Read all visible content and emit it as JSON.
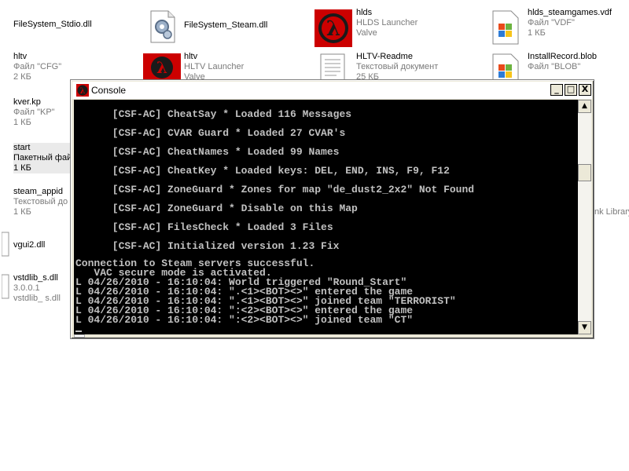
{
  "desktop": {
    "left_files": [
      {
        "name": "FileSystem_Stdio.dll",
        "sub1": "",
        "sub2": ""
      },
      {
        "name": "hltv",
        "sub1": "Файл \"CFG\"",
        "sub2": "2 КБ"
      },
      {
        "name": "kver.kp",
        "sub1": "Файл \"KP\"",
        "sub2": "1 КБ"
      },
      {
        "name": "start",
        "sub1": "Пакетный файл",
        "sub2": "1 КБ"
      },
      {
        "name": "steam_appid",
        "sub1": "Текстовый до",
        "sub2": "1 КБ"
      },
      {
        "name": "vgui2.dll",
        "sub1": "",
        "sub2": ""
      },
      {
        "name": "vstdlib_s.dll",
        "sub1": "3.0.0.1",
        "sub2": "vstdlib_ s.dll"
      }
    ],
    "mid_files": [
      {
        "name": "FileSystem_Steam.dll",
        "sub1": "",
        "sub2": ""
      },
      {
        "name": "hltv",
        "sub1": "HLTV Launcher",
        "sub2": "Valve"
      }
    ],
    "right_files": [
      {
        "name": "hlds",
        "sub1": "HLDS Launcher",
        "sub2": "Valve"
      },
      {
        "name": "HLTV-Readme",
        "sub1": "Текстовый документ",
        "sub2": "25 КБ"
      }
    ],
    "far_files": [
      {
        "name": "hlds_steamgames.vdf",
        "sub1": "Файл \"VDF\"",
        "sub2": "1 КБ"
      },
      {
        "name": "InstallRecord.blob",
        "sub1": "Файл \"BLOB\"",
        "sub2": "1 КБ"
      }
    ],
    "partial_text": "nk Library"
  },
  "console": {
    "title": "Console",
    "minimize_glyph": "_",
    "maximize_glyph": "□",
    "close_glyph": "X",
    "scroll_up_glyph": "▲",
    "scroll_down_glyph": "▼",
    "plugin_lines": [
      "      [CSF-AC] CheatSay * Loaded 116 Messages",
      "      [CSF-AC] CVAR Guard * Loaded 27 CVAR's",
      "      [CSF-AC] CheatNames * Loaded 99 Names",
      "      [CSF-AC] CheatKey * Loaded keys: DEL, END, INS, F9, F12",
      "      [CSF-AC] ZoneGuard * Zones for map \"de_dust2_2x2\" Not Found",
      "      [CSF-AC] ZoneGuard * Disable on this Map",
      "      [CSF-AC] FilesCheck * Loaded 3 Files",
      "      [CSF-AC] Initialized version 1.23 Fix"
    ],
    "log_lines": [
      "Connection to Steam servers successful.",
      "   VAC secure mode is activated.",
      "L 04/26/2010 - 16:10:04: World triggered \"Round_Start\"",
      "L 04/26/2010 - 16:10:04: \".<1><BOT><>\" entered the game",
      "L 04/26/2010 - 16:10:04: \".<1><BOT><>\" joined team \"TERRORIST\"",
      "L 04/26/2010 - 16:10:04: \":<2><BOT><>\" entered the game",
      "L 04/26/2010 - 16:10:04: \":<2><BOT><>\" joined team \"CT\""
    ]
  },
  "colors": {
    "console_bg": "#000000",
    "console_text": "#c0c0c0",
    "window_frame": "#ece9d8",
    "hl_red": "#cc0000"
  }
}
